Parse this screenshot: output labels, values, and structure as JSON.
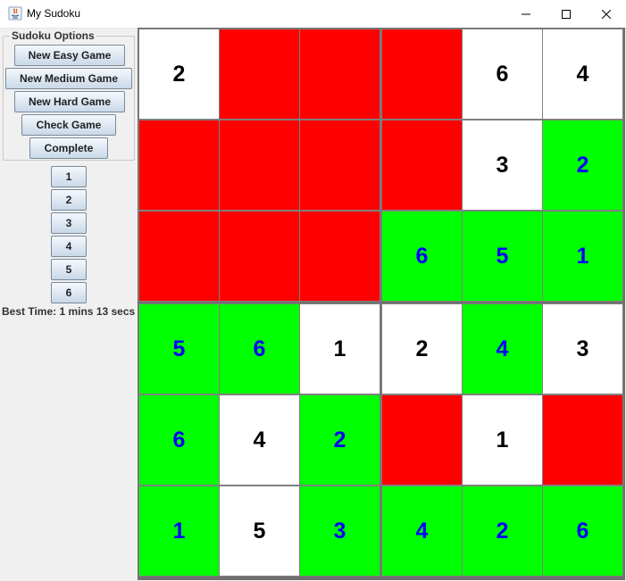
{
  "window": {
    "title": "My Sudoku"
  },
  "options": {
    "legend": "Sudoku Options",
    "easy": "New Easy Game",
    "medium": "New Medium Game",
    "hard": "New Hard Game",
    "check": "Check Game",
    "complete": "Complete"
  },
  "number_buttons": [
    "1",
    "2",
    "3",
    "4",
    "5",
    "6"
  ],
  "best_time": "Best Time: 1 mins 13 secs",
  "colors": {
    "white_cell": "#ffffff",
    "red_cell": "#ff0000",
    "green_cell": "#00ff00",
    "given_text": "#000000",
    "entered_text": "#0000ff"
  },
  "board": {
    "rows": [
      [
        {
          "v": "2",
          "s": "white"
        },
        {
          "v": "",
          "s": "red"
        },
        {
          "v": "",
          "s": "red"
        },
        {
          "v": "",
          "s": "red"
        },
        {
          "v": "6",
          "s": "white"
        },
        {
          "v": "4",
          "s": "white"
        }
      ],
      [
        {
          "v": "",
          "s": "red"
        },
        {
          "v": "",
          "s": "red"
        },
        {
          "v": "",
          "s": "red"
        },
        {
          "v": "",
          "s": "red"
        },
        {
          "v": "3",
          "s": "white"
        },
        {
          "v": "2",
          "s": "green"
        }
      ],
      [
        {
          "v": "",
          "s": "red"
        },
        {
          "v": "",
          "s": "red"
        },
        {
          "v": "",
          "s": "red"
        },
        {
          "v": "6",
          "s": "green"
        },
        {
          "v": "5",
          "s": "green"
        },
        {
          "v": "1",
          "s": "green"
        }
      ],
      [
        {
          "v": "5",
          "s": "green"
        },
        {
          "v": "6",
          "s": "green"
        },
        {
          "v": "1",
          "s": "white"
        },
        {
          "v": "2",
          "s": "white"
        },
        {
          "v": "4",
          "s": "green"
        },
        {
          "v": "3",
          "s": "white"
        }
      ],
      [
        {
          "v": "6",
          "s": "green"
        },
        {
          "v": "4",
          "s": "white"
        },
        {
          "v": "2",
          "s": "green"
        },
        {
          "v": "",
          "s": "red"
        },
        {
          "v": "1",
          "s": "white"
        },
        {
          "v": "",
          "s": "red"
        }
      ],
      [
        {
          "v": "1",
          "s": "green"
        },
        {
          "v": "5",
          "s": "white"
        },
        {
          "v": "3",
          "s": "green"
        },
        {
          "v": "4",
          "s": "green"
        },
        {
          "v": "2",
          "s": "green"
        },
        {
          "v": "6",
          "s": "green"
        }
      ]
    ]
  }
}
